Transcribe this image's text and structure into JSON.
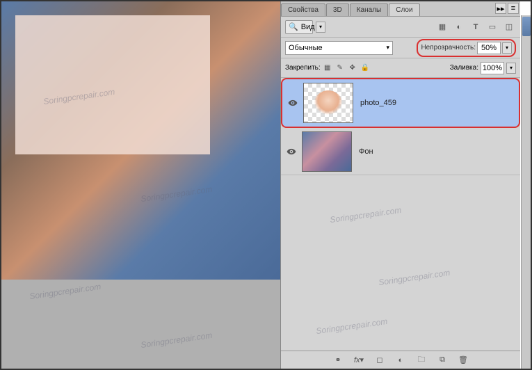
{
  "tabs": {
    "properties": "Свойства",
    "threeD": "3D",
    "channels": "Каналы",
    "layers": "Слои"
  },
  "filter": {
    "kind_label": "Вид"
  },
  "blend": {
    "mode": "Обычные",
    "opacity_label": "Непрозрачность:",
    "opacity_value": "50%"
  },
  "lock": {
    "label": "Закрепить:",
    "fill_label": "Заливка:",
    "fill_value": "100%"
  },
  "layers": [
    {
      "name": "photo_459",
      "selected": true
    },
    {
      "name": "Фон",
      "selected": false
    }
  ],
  "watermark_text": "Soringpcrepair.com"
}
